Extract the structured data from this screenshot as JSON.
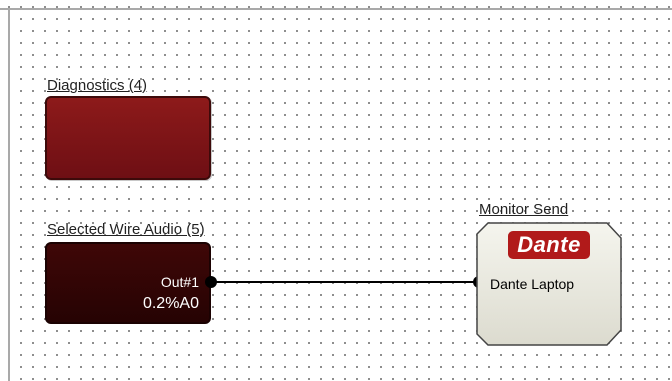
{
  "blocks": {
    "diagnostics": {
      "label": "Diagnostics (4)"
    },
    "selected_wire_audio": {
      "label": "Selected Wire Audio (5)",
      "output_label": "Out#1",
      "output_value": "0.2%A0"
    },
    "monitor_send": {
      "label": "Monitor Send",
      "logo_text": "Dante",
      "device": "Dante Laptop"
    }
  },
  "colors": {
    "diagnostics_fill": "#7e1218",
    "audio_fill": "#330505",
    "dante_logo": "#b11a1a",
    "dante_body": "#ecebdf"
  },
  "icons": [
    "input-port-icon",
    "output-port-icon",
    "dante-logo"
  ]
}
